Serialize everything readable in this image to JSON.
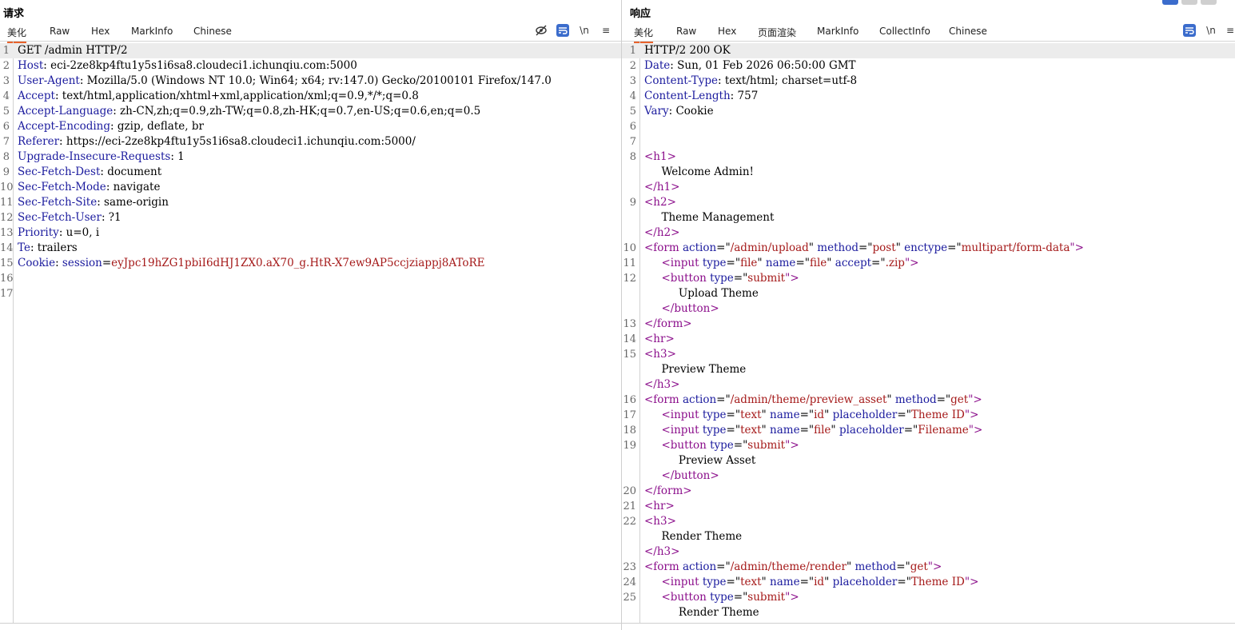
{
  "request": {
    "title": "请求",
    "tabs": [
      "美化",
      "Raw",
      "Hex",
      "MarkInfo",
      "Chinese"
    ],
    "active_tab": "美化",
    "tools": {
      "hide": "⊘",
      "newline": "\\n",
      "menu": "≡"
    },
    "lines": [
      {
        "n": "1",
        "parts": [
          {
            "t": "GET /admin HTTP/2",
            "c": "hv"
          }
        ]
      },
      {
        "n": "2",
        "parts": [
          {
            "t": "Host",
            "c": "hk"
          },
          {
            "t": ": eci-2ze8kp4ftu1y5s1i6sa8.cloudeci1.ichunqiu.com:5000",
            "c": "hv"
          }
        ]
      },
      {
        "n": "3",
        "parts": [
          {
            "t": "User-Agent",
            "c": "hk"
          },
          {
            "t": ": Mozilla/5.0 (Windows NT 10.0; Win64; x64; rv:147.0) Gecko/20100101 Firefox/147.0",
            "c": "hv"
          }
        ]
      },
      {
        "n": "4",
        "parts": [
          {
            "t": "Accept",
            "c": "hk"
          },
          {
            "t": ": text/html,application/xhtml+xml,application/xml;q=0.9,*/*;q=0.8",
            "c": "hv"
          }
        ]
      },
      {
        "n": "5",
        "parts": [
          {
            "t": "Accept-Language",
            "c": "hk"
          },
          {
            "t": ": zh-CN,zh;q=0.9,zh-TW;q=0.8,zh-HK;q=0.7,en-US;q=0.6,en;q=0.5",
            "c": "hv"
          }
        ]
      },
      {
        "n": "6",
        "parts": [
          {
            "t": "Accept-Encoding",
            "c": "hk"
          },
          {
            "t": ": gzip, deflate, br",
            "c": "hv"
          }
        ]
      },
      {
        "n": "7",
        "parts": [
          {
            "t": "Referer",
            "c": "hk"
          },
          {
            "t": ": https://eci-2ze8kp4ftu1y5s1i6sa8.cloudeci1.ichunqiu.com:5000/",
            "c": "hv"
          }
        ]
      },
      {
        "n": "8",
        "parts": [
          {
            "t": "Upgrade-Insecure-Requests",
            "c": "hk"
          },
          {
            "t": ": 1",
            "c": "hv"
          }
        ]
      },
      {
        "n": "9",
        "parts": [
          {
            "t": "Sec-Fetch-Dest",
            "c": "hk"
          },
          {
            "t": ": document",
            "c": "hv"
          }
        ]
      },
      {
        "n": "10",
        "parts": [
          {
            "t": "Sec-Fetch-Mode",
            "c": "hk"
          },
          {
            "t": ": navigate",
            "c": "hv"
          }
        ]
      },
      {
        "n": "11",
        "parts": [
          {
            "t": "Sec-Fetch-Site",
            "c": "hk"
          },
          {
            "t": ": same-origin",
            "c": "hv"
          }
        ]
      },
      {
        "n": "12",
        "parts": [
          {
            "t": "Sec-Fetch-User",
            "c": "hk"
          },
          {
            "t": ": ?1",
            "c": "hv"
          }
        ]
      },
      {
        "n": "13",
        "parts": [
          {
            "t": "Priority",
            "c": "hk"
          },
          {
            "t": ": u=0, i",
            "c": "hv"
          }
        ]
      },
      {
        "n": "14",
        "parts": [
          {
            "t": "Te",
            "c": "hk"
          },
          {
            "t": ": trailers",
            "c": "hv"
          }
        ]
      },
      {
        "n": "15",
        "parts": [
          {
            "t": "Cookie",
            "c": "hk"
          },
          {
            "t": ": ",
            "c": "hv"
          },
          {
            "t": "session",
            "c": "cookie-name"
          },
          {
            "t": "=",
            "c": "hv"
          },
          {
            "t": "eyJpc19hZG1pbiI6dHJ1ZX0.aX70_g.HtR-X7ew9AP5ccjziappj8AToRE",
            "c": "cookie-val"
          }
        ]
      },
      {
        "n": "16",
        "parts": []
      },
      {
        "n": "17",
        "parts": []
      }
    ]
  },
  "response": {
    "title": "响应",
    "tabs": [
      "美化",
      "Raw",
      "Hex",
      "页面渲染",
      "MarkInfo",
      "CollectInfo",
      "Chinese"
    ],
    "active_tab": "美化",
    "tools": {
      "newline": "\\n",
      "menu": "≡"
    },
    "lines": [
      {
        "n": "1",
        "parts": [
          {
            "t": "HTTP/2 200 OK",
            "c": "hv"
          }
        ]
      },
      {
        "n": "2",
        "parts": [
          {
            "t": "Date",
            "c": "hk"
          },
          {
            "t": ": Sun, 01 Feb 2026 06:50:00 GMT",
            "c": "hv"
          }
        ]
      },
      {
        "n": "3",
        "parts": [
          {
            "t": "Content-Type",
            "c": "hk"
          },
          {
            "t": ": text/html; charset=utf-8",
            "c": "hv"
          }
        ]
      },
      {
        "n": "4",
        "parts": [
          {
            "t": "Content-Length",
            "c": "hk"
          },
          {
            "t": ": 757",
            "c": "hv"
          }
        ]
      },
      {
        "n": "5",
        "parts": [
          {
            "t": "Vary",
            "c": "hk"
          },
          {
            "t": ": Cookie",
            "c": "hv"
          }
        ]
      },
      {
        "n": "6",
        "parts": []
      },
      {
        "n": "7",
        "parts": []
      },
      {
        "n": "8",
        "parts": [
          {
            "t": "<h1>",
            "c": "tag"
          }
        ]
      },
      {
        "n": "",
        "parts": [
          {
            "t": "     Welcome Admin!",
            "c": "hv"
          }
        ]
      },
      {
        "n": "",
        "parts": [
          {
            "t": "</h1>",
            "c": "tag"
          }
        ]
      },
      {
        "n": "9",
        "parts": [
          {
            "t": "<h2>",
            "c": "tag"
          }
        ]
      },
      {
        "n": "",
        "parts": [
          {
            "t": "     Theme Management",
            "c": "hv"
          }
        ]
      },
      {
        "n": "",
        "parts": [
          {
            "t": "</h2>",
            "c": "tag"
          }
        ]
      },
      {
        "n": "10",
        "parts": [
          {
            "t": "<form ",
            "c": "tag"
          },
          {
            "t": "action",
            "c": "attr"
          },
          {
            "t": "=\"",
            "c": "hv"
          },
          {
            "t": "/admin/upload",
            "c": "aval"
          },
          {
            "t": "\" ",
            "c": "hv"
          },
          {
            "t": "method",
            "c": "attr"
          },
          {
            "t": "=\"",
            "c": "hv"
          },
          {
            "t": "post",
            "c": "aval"
          },
          {
            "t": "\" ",
            "c": "hv"
          },
          {
            "t": "enctype",
            "c": "attr"
          },
          {
            "t": "=\"",
            "c": "hv"
          },
          {
            "t": "multipart/form-data",
            "c": "aval"
          },
          {
            "t": "\">",
            "c": "tag"
          }
        ]
      },
      {
        "n": "11",
        "parts": [
          {
            "t": "     <input ",
            "c": "tag"
          },
          {
            "t": "type",
            "c": "attr"
          },
          {
            "t": "=\"",
            "c": "hv"
          },
          {
            "t": "file",
            "c": "aval"
          },
          {
            "t": "\" ",
            "c": "hv"
          },
          {
            "t": "name",
            "c": "attr"
          },
          {
            "t": "=\"",
            "c": "hv"
          },
          {
            "t": "file",
            "c": "aval"
          },
          {
            "t": "\" ",
            "c": "hv"
          },
          {
            "t": "accept",
            "c": "attr"
          },
          {
            "t": "=\"",
            "c": "hv"
          },
          {
            "t": ".zip",
            "c": "aval"
          },
          {
            "t": "\">",
            "c": "tag"
          }
        ]
      },
      {
        "n": "12",
        "parts": [
          {
            "t": "     <button ",
            "c": "tag"
          },
          {
            "t": "type",
            "c": "attr"
          },
          {
            "t": "=\"",
            "c": "hv"
          },
          {
            "t": "submit",
            "c": "aval"
          },
          {
            "t": "\">",
            "c": "tag"
          }
        ]
      },
      {
        "n": "",
        "parts": [
          {
            "t": "          Upload Theme",
            "c": "hv"
          }
        ]
      },
      {
        "n": "",
        "parts": [
          {
            "t": "     </button>",
            "c": "tag"
          }
        ]
      },
      {
        "n": "13",
        "parts": [
          {
            "t": "</form>",
            "c": "tag"
          }
        ]
      },
      {
        "n": "14",
        "parts": [
          {
            "t": "<hr>",
            "c": "tag"
          }
        ]
      },
      {
        "n": "15",
        "parts": [
          {
            "t": "<h3>",
            "c": "tag"
          }
        ]
      },
      {
        "n": "",
        "parts": [
          {
            "t": "     Preview Theme",
            "c": "hv"
          }
        ]
      },
      {
        "n": "",
        "parts": [
          {
            "t": "</h3>",
            "c": "tag"
          }
        ]
      },
      {
        "n": "16",
        "parts": [
          {
            "t": "<form ",
            "c": "tag"
          },
          {
            "t": "action",
            "c": "attr"
          },
          {
            "t": "=\"",
            "c": "hv"
          },
          {
            "t": "/admin/theme/preview_asset",
            "c": "aval"
          },
          {
            "t": "\" ",
            "c": "hv"
          },
          {
            "t": "method",
            "c": "attr"
          },
          {
            "t": "=\"",
            "c": "hv"
          },
          {
            "t": "get",
            "c": "aval"
          },
          {
            "t": "\">",
            "c": "tag"
          }
        ]
      },
      {
        "n": "17",
        "parts": [
          {
            "t": "     <input ",
            "c": "tag"
          },
          {
            "t": "type",
            "c": "attr"
          },
          {
            "t": "=\"",
            "c": "hv"
          },
          {
            "t": "text",
            "c": "aval"
          },
          {
            "t": "\" ",
            "c": "hv"
          },
          {
            "t": "name",
            "c": "attr"
          },
          {
            "t": "=\"",
            "c": "hv"
          },
          {
            "t": "id",
            "c": "aval"
          },
          {
            "t": "\" ",
            "c": "hv"
          },
          {
            "t": "placeholder",
            "c": "attr"
          },
          {
            "t": "=\"",
            "c": "hv"
          },
          {
            "t": "Theme ID",
            "c": "aval"
          },
          {
            "t": "\">",
            "c": "tag"
          }
        ]
      },
      {
        "n": "18",
        "parts": [
          {
            "t": "     <input ",
            "c": "tag"
          },
          {
            "t": "type",
            "c": "attr"
          },
          {
            "t": "=\"",
            "c": "hv"
          },
          {
            "t": "text",
            "c": "aval"
          },
          {
            "t": "\" ",
            "c": "hv"
          },
          {
            "t": "name",
            "c": "attr"
          },
          {
            "t": "=\"",
            "c": "hv"
          },
          {
            "t": "file",
            "c": "aval"
          },
          {
            "t": "\" ",
            "c": "hv"
          },
          {
            "t": "placeholder",
            "c": "attr"
          },
          {
            "t": "=\"",
            "c": "hv"
          },
          {
            "t": "Filename",
            "c": "aval"
          },
          {
            "t": "\">",
            "c": "tag"
          }
        ]
      },
      {
        "n": "19",
        "parts": [
          {
            "t": "     <button ",
            "c": "tag"
          },
          {
            "t": "type",
            "c": "attr"
          },
          {
            "t": "=\"",
            "c": "hv"
          },
          {
            "t": "submit",
            "c": "aval"
          },
          {
            "t": "\">",
            "c": "tag"
          }
        ]
      },
      {
        "n": "",
        "parts": [
          {
            "t": "          Preview Asset",
            "c": "hv"
          }
        ]
      },
      {
        "n": "",
        "parts": [
          {
            "t": "     </button>",
            "c": "tag"
          }
        ]
      },
      {
        "n": "20",
        "parts": [
          {
            "t": "</form>",
            "c": "tag"
          }
        ]
      },
      {
        "n": "21",
        "parts": [
          {
            "t": "<hr>",
            "c": "tag"
          }
        ]
      },
      {
        "n": "22",
        "parts": [
          {
            "t": "<h3>",
            "c": "tag"
          }
        ]
      },
      {
        "n": "",
        "parts": [
          {
            "t": "     Render Theme",
            "c": "hv"
          }
        ]
      },
      {
        "n": "",
        "parts": [
          {
            "t": "</h3>",
            "c": "tag"
          }
        ]
      },
      {
        "n": "23",
        "parts": [
          {
            "t": "<form ",
            "c": "tag"
          },
          {
            "t": "action",
            "c": "attr"
          },
          {
            "t": "=\"",
            "c": "hv"
          },
          {
            "t": "/admin/theme/render",
            "c": "aval"
          },
          {
            "t": "\" ",
            "c": "hv"
          },
          {
            "t": "method",
            "c": "attr"
          },
          {
            "t": "=\"",
            "c": "hv"
          },
          {
            "t": "get",
            "c": "aval"
          },
          {
            "t": "\">",
            "c": "tag"
          }
        ]
      },
      {
        "n": "24",
        "parts": [
          {
            "t": "     <input ",
            "c": "tag"
          },
          {
            "t": "type",
            "c": "attr"
          },
          {
            "t": "=\"",
            "c": "hv"
          },
          {
            "t": "text",
            "c": "aval"
          },
          {
            "t": "\" ",
            "c": "hv"
          },
          {
            "t": "name",
            "c": "attr"
          },
          {
            "t": "=\"",
            "c": "hv"
          },
          {
            "t": "id",
            "c": "aval"
          },
          {
            "t": "\" ",
            "c": "hv"
          },
          {
            "t": "placeholder",
            "c": "attr"
          },
          {
            "t": "=\"",
            "c": "hv"
          },
          {
            "t": "Theme ID",
            "c": "aval"
          },
          {
            "t": "\">",
            "c": "tag"
          }
        ]
      },
      {
        "n": "25",
        "parts": [
          {
            "t": "     <button ",
            "c": "tag"
          },
          {
            "t": "type",
            "c": "attr"
          },
          {
            "t": "=\"",
            "c": "hv"
          },
          {
            "t": "submit",
            "c": "aval"
          },
          {
            "t": "\">",
            "c": "tag"
          }
        ]
      },
      {
        "n": "",
        "parts": [
          {
            "t": "          Render Theme",
            "c": "hv"
          }
        ]
      }
    ]
  },
  "colors": {
    "accent": "#e8622b",
    "wrap_button": "#3b6ccc",
    "header_key": "#1b1b9e",
    "tag": "#8b0e8b",
    "attr_value": "#a51a1a"
  }
}
